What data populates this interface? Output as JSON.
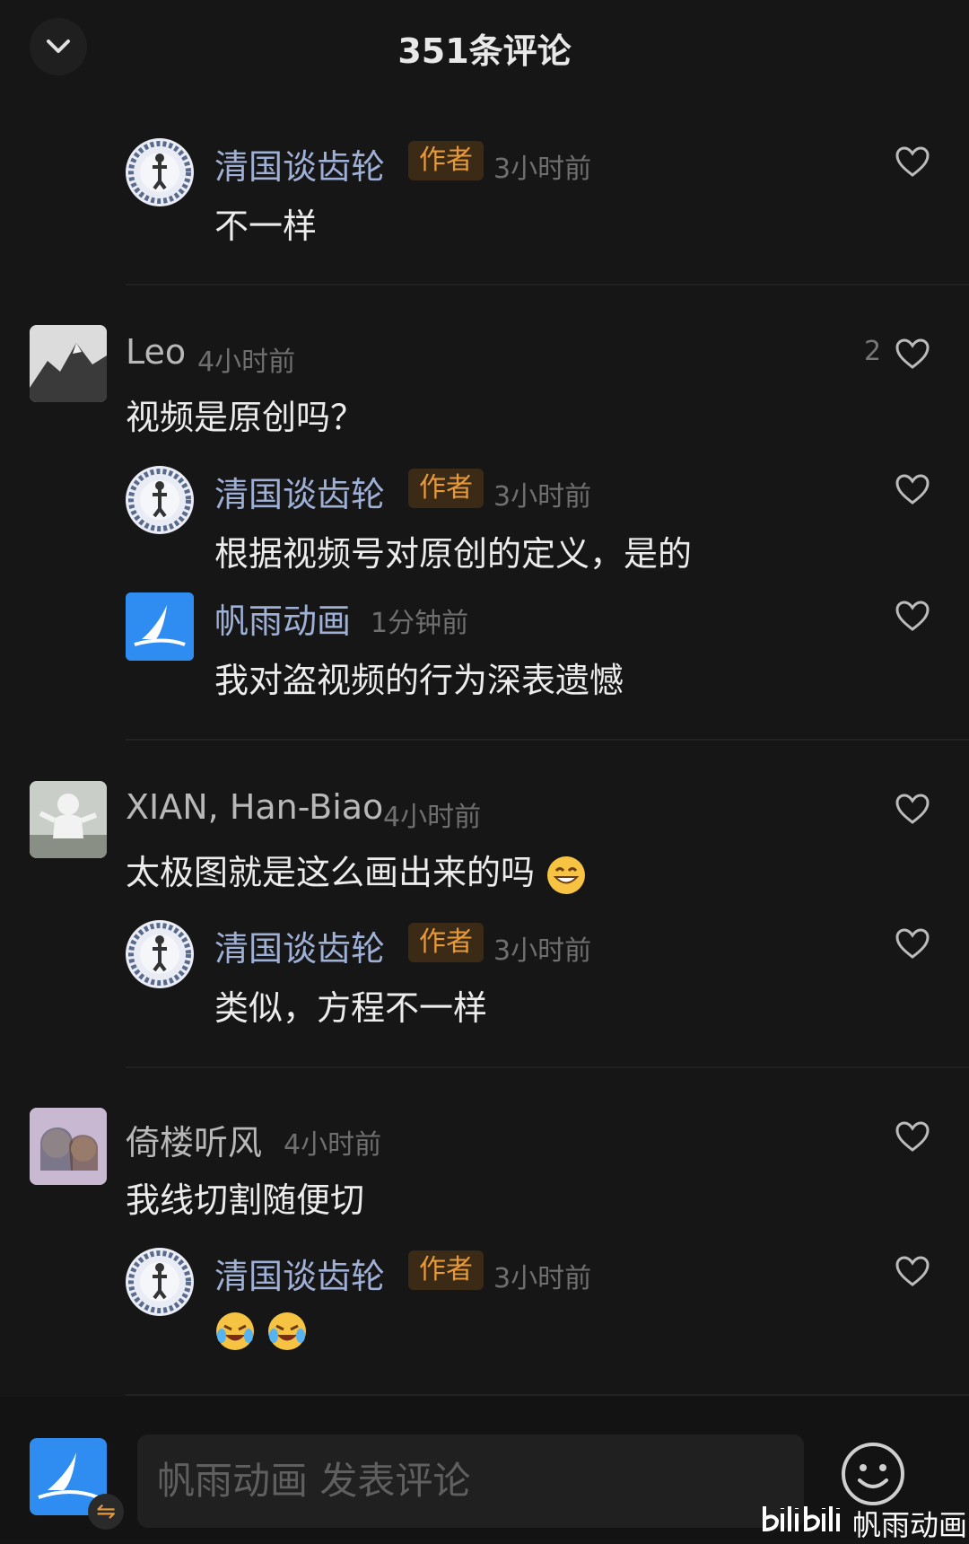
{
  "header": {
    "title": "351条评论"
  },
  "thread1": {
    "reply": {
      "name": "清国谈齿轮",
      "badge": "作者",
      "time": "3小时前",
      "text": "不一样"
    }
  },
  "thread2": {
    "main": {
      "name": "Leo",
      "time": "4小时前",
      "text": "视频是原创吗？",
      "likes": "2"
    },
    "reply1": {
      "name": "清国谈齿轮",
      "badge": "作者",
      "time": "3小时前",
      "text": "根据视频号对原创的定义，是的"
    },
    "reply2": {
      "name": "帆雨动画",
      "time": "1分钟前",
      "text": "我对盗视频的行为深表遗憾"
    }
  },
  "thread3": {
    "main": {
      "name": "XIAN, Han-Biao",
      "time": "4小时前",
      "text": "太极图就是这么画出来的吗"
    },
    "reply": {
      "name": "清国谈齿轮",
      "badge": "作者",
      "time": "3小时前",
      "text": "类似，方程不一样"
    }
  },
  "thread4": {
    "main": {
      "name": "倚楼听风",
      "time": "4小时前",
      "text": "我线切割随便切"
    },
    "reply": {
      "name": "清国谈齿轮",
      "badge": "作者",
      "time": "3小时前"
    }
  },
  "composer": {
    "placeholder": "帆雨动画 发表评论"
  },
  "watermark": {
    "text": "帆雨动画",
    "brand": "bilibili"
  },
  "colors": {
    "badge": "#e89a3a",
    "reply_name": "#9fb0d6",
    "accent": "#2f8cf0"
  }
}
